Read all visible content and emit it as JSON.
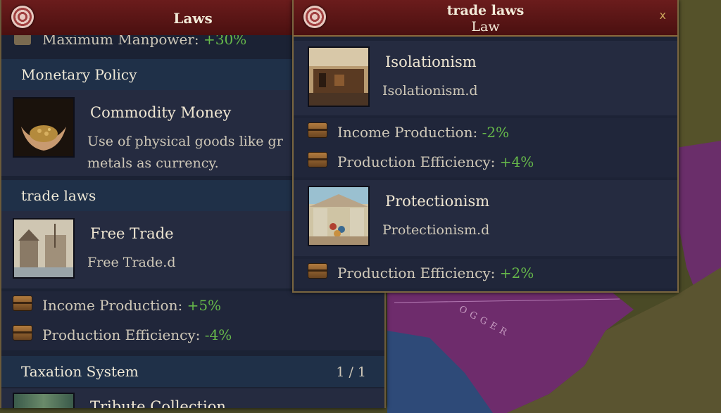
{
  "map": {
    "label": "OGGER"
  },
  "laws_panel": {
    "title": "Laws",
    "manpower": {
      "label": "Maximum Manpower:",
      "value": "+30%"
    },
    "monetary_policy": {
      "header": "Monetary Policy",
      "law_name": "Commodity Money",
      "description_line1": "Use of physical goods like gr",
      "description_line2": "metals as currency."
    },
    "trade_laws": {
      "header": "trade laws",
      "law_name": "Free Trade",
      "law_desc": "Free Trade.d",
      "effects": [
        {
          "label": "Income Production:",
          "value": "+5%"
        },
        {
          "label": "Production Efficiency:",
          "value": "-4%"
        }
      ]
    },
    "taxation": {
      "header": "Taxation System",
      "counter": "1 / 1",
      "partial_text": "Tribute Collection"
    }
  },
  "trade_panel": {
    "title": "trade laws",
    "subtitle": "Law",
    "close": "x",
    "laws": [
      {
        "name": "Isolationism",
        "desc": "Isolationism.d",
        "effects": [
          {
            "label": "Income Production:",
            "value": "-2%"
          },
          {
            "label": "Production Efficiency:",
            "value": "+4%"
          }
        ]
      },
      {
        "name": "Protectionism",
        "desc": "Protectionism.d",
        "effects": [
          {
            "label": "Production Efficiency:",
            "value": "+2%"
          }
        ]
      }
    ]
  }
}
